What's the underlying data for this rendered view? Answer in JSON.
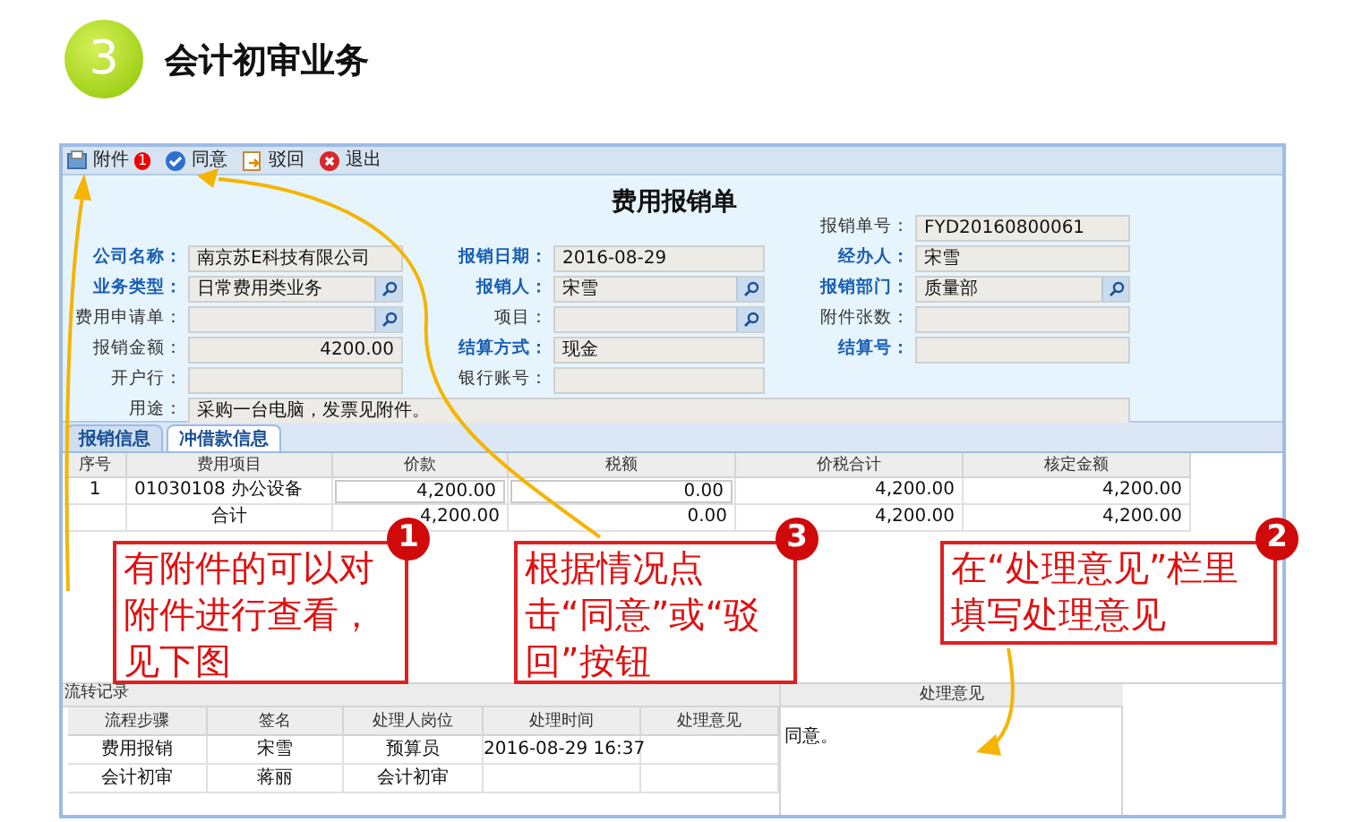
{
  "step": {
    "number": "3",
    "title": "会计初审业务"
  },
  "toolbar": [
    {
      "kind": "attachment",
      "label": "附件",
      "badge": "1"
    },
    {
      "kind": "approve",
      "label": "同意"
    },
    {
      "kind": "reject",
      "label": "驳回"
    },
    {
      "kind": "exit",
      "label": "退出"
    }
  ],
  "form": {
    "title": "费用报销单",
    "rows": [
      [
        null,
        null,
        {
          "label": "报销单号：",
          "value": "FYD20160800061",
          "kind": "text",
          "required": false
        }
      ],
      [
        {
          "label": "公司名称：",
          "value": "南京苏E科技有限公司",
          "kind": "text",
          "required": true
        },
        {
          "label": "报销日期：",
          "value": "2016-08-29",
          "kind": "text",
          "required": true
        },
        {
          "label": "经办人：",
          "value": "宋雪",
          "kind": "text",
          "required": true
        }
      ],
      [
        {
          "label": "业务类型：",
          "value": "日常费用类业务",
          "kind": "lookup",
          "required": true
        },
        {
          "label": "报销人：",
          "value": "宋雪",
          "kind": "lookup",
          "required": true
        },
        {
          "label": "报销部门：",
          "value": "质量部",
          "kind": "lookup",
          "required": true
        }
      ],
      [
        {
          "label": "费用申请单：",
          "kind": "lookup",
          "required": false
        },
        {
          "label": "项目：",
          "kind": "lookup",
          "required": false
        },
        {
          "label": "附件张数：",
          "kind": "text",
          "required": false
        }
      ],
      [
        {
          "label": "报销金额：",
          "value": "4200.00",
          "kind": "amount",
          "required": false
        },
        {
          "label": "结算方式：",
          "value": "现金",
          "kind": "text",
          "required": true
        },
        {
          "label": "结算号：",
          "kind": "text",
          "required": true
        }
      ],
      [
        {
          "label": "开户行：",
          "kind": "text",
          "required": false
        },
        {
          "label": "银行账号：",
          "kind": "text",
          "required": false
        },
        null
      ],
      [
        {
          "label": "用途：",
          "value": "采购一台电脑，发票见附件。",
          "kind": "memo",
          "required": false
        }
      ]
    ]
  },
  "tabs": [
    {
      "label": "报销信息",
      "selected": false
    },
    {
      "label": "冲借款信息",
      "selected": true
    }
  ],
  "grid": {
    "columns": [
      "序号",
      "费用项目",
      "价款",
      "税额",
      "价税合计",
      "核定金额"
    ],
    "rows": [
      {
        "editing": true,
        "cells": [
          "1",
          "01030108 办公设备",
          "4,200.00",
          "0.00",
          "4,200.00",
          "4,200.00"
        ]
      },
      {
        "editing": false,
        "cells": [
          null,
          "合计",
          "4,200.00",
          "0.00",
          "4,200.00",
          "4,200.00"
        ]
      }
    ]
  },
  "flow": {
    "title": "流转记录",
    "columns": [
      "流程步骤",
      "签名",
      "处理人岗位",
      "处理时间",
      "处理意见"
    ],
    "rows": [
      [
        "费用报销",
        "宋雪",
        "预算员",
        "2016-08-29 16:37",
        null
      ],
      [
        "会计初审",
        "蒋丽",
        "会计初审",
        null,
        null
      ]
    ]
  },
  "opinion": {
    "title": "处理意见",
    "value": "同意。"
  },
  "callouts": [
    {
      "number": "1",
      "text": "有附件的可以对附件进行查看，见下图"
    },
    {
      "number": "3",
      "text": "根据情况点击“同意”或“驳回”按钮"
    },
    {
      "number": "2",
      "text": "在“处理意见”栏里填写处理意见"
    }
  ]
}
